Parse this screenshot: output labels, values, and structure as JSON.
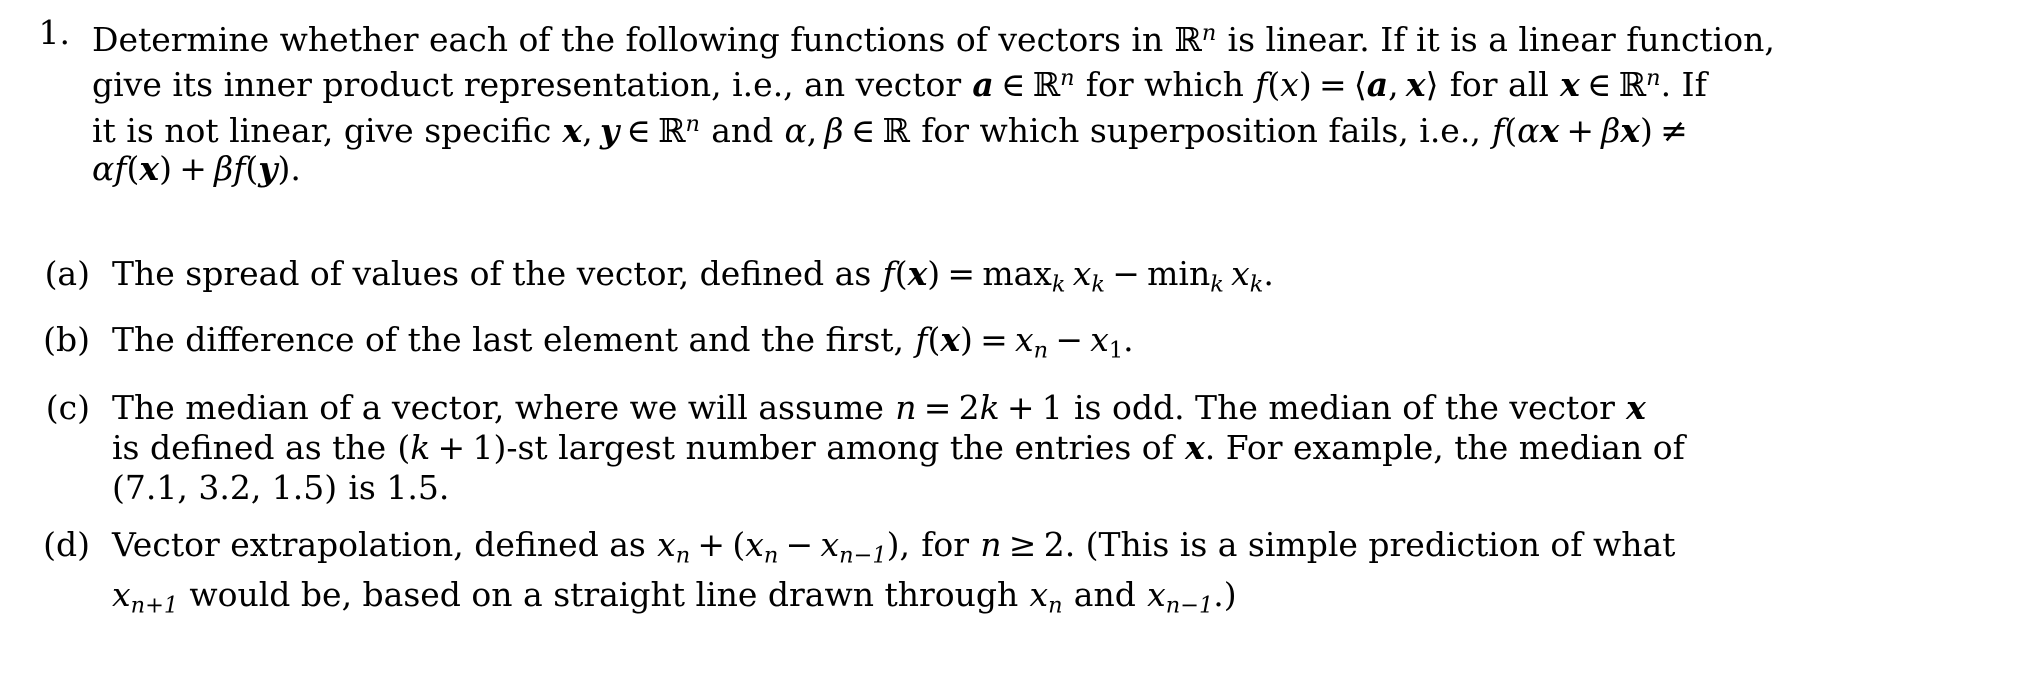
{
  "document": {
    "type": "latex-homework-problem",
    "background_color": "#ffffff",
    "text_color": "#000000"
  },
  "problem": {
    "number": "1.",
    "statement_lines": [
      "Determine whether each of the following functions of vectors in ℝⁿ is linear. If it is a linear function,",
      "give its inner product representation, i.e., an vector a ∈ ℝⁿ for which f(x) = ⟨a, x⟩ for all x ∈ ℝⁿ. If",
      "it is not linear, give specific x, y ∈ ℝⁿ and α, β ∈ ℝ for which superposition fails, i.e., f(αx + βx) ≠",
      "αf(x) + βf(y)."
    ],
    "line1": {
      "seg1": "Determine whether each of the following functions of vectors in",
      "R": "R",
      "exp_n": "n",
      "seg2": "is linear. If it is a linear function,"
    },
    "line2": {
      "seg1": "give its inner product representation, i.e., an vector",
      "a": "a",
      "in1": "∈",
      "R1": "R",
      "exp_n1": "n",
      "seg2": "for which",
      "f": "f",
      "paren_open": "(",
      "x_italic": "x",
      "paren_close": ")",
      "equals": "=",
      "angle_open": "⟨",
      "a2": "a",
      "comma": ",",
      "x_bold": "x",
      "angle_close": "⟩",
      "seg3": "for all",
      "x_bold2": "x",
      "in2": "∈",
      "R2": "R",
      "exp_n2": "n",
      "seg4": ". If"
    },
    "line3": {
      "seg1": "it is not linear, give specific",
      "x": "x",
      "comma1": ",",
      "y": "y",
      "in1": "∈",
      "R1": "R",
      "exp_n": "n",
      "seg2": "and",
      "alpha": "α",
      "comma2": ",",
      "beta": "β",
      "in2": "∈",
      "R2": "R",
      "seg3": "for which superposition fails, i.e.,",
      "f": "f",
      "paren_open": "(",
      "alpha2": "α",
      "x2": "x",
      "plus": "+",
      "beta2": "β",
      "x3": "x",
      "paren_close": ")",
      "neq": "≠"
    },
    "line4": {
      "alpha": "α",
      "f1": "f",
      "po1": "(",
      "x": "x",
      "pc1": ")",
      "plus": "+",
      "beta": "β",
      "f2": "f",
      "po2": "(",
      "y": "y",
      "pc2": ")",
      "period": "."
    }
  },
  "subitems": [
    {
      "label": "(a)",
      "id": "item-a",
      "text": "The spread of values of the vector, defined as f(x) = max_k x_k − min_k x_k.",
      "parts": {
        "seg1": "The spread of values of the vector, defined as",
        "f": "f",
        "po": "(",
        "x_bold": "x",
        "pc": ")",
        "eq": "=",
        "max": "max",
        "sub_k1": "k",
        "x1": "x",
        "sub_k2": "k",
        "minus": "−",
        "min": "min",
        "sub_k3": "k",
        "x2": "x",
        "sub_k4": "k",
        "period": "."
      }
    },
    {
      "label": "(b)",
      "id": "item-b",
      "text": "The difference of the last element and the first, f(x) = x_n − x_1.",
      "parts": {
        "seg1": "The difference of the last element and the first,",
        "f": "f",
        "po": "(",
        "x_bold": "x",
        "pc": ")",
        "eq": "=",
        "x1": "x",
        "sub_n": "n",
        "minus": "−",
        "x2": "x",
        "sub_1": "1",
        "period": "."
      }
    },
    {
      "label": "(c)",
      "id": "item-c",
      "text": "The median of a vector, where we will assume n = 2k + 1 is odd. The median of the vector x is defined as the (k + 1)-st largest number among the entries of x. For example, the median of (7.1, 3.2, 1.5) is 1.5.",
      "lines": {
        "l1_seg1": "The median of a vector, where we will assume",
        "l1_n": "n",
        "l1_eq": "=",
        "l1_2": "2",
        "l1_k": "k",
        "l1_plus": "+",
        "l1_1": "1",
        "l1_seg2": "is odd.  The median of the vector",
        "l1_x": "x",
        "l2_seg1": "is defined as the",
        "l2_po": "(",
        "l2_k": "k",
        "l2_plus": "+",
        "l2_1": "1",
        "l2_pc": ")",
        "l2_seg2": "-st largest number among the entries of",
        "l2_x": "x",
        "l2_seg3": ". For example, the median of",
        "l3_nums": "(7.1, 3.2, 1.5)",
        "l3_seg": "is 1.5."
      }
    },
    {
      "label": "(d)",
      "id": "item-d",
      "text": "Vector extrapolation, defined as x_n + (x_n − x_{n−1}), for n ≥ 2. (This is a simple prediction of what x_{n+1} would be, based on a straight line drawn through x_n and x_{n−1}.)",
      "lines": {
        "l1_seg1": "Vector extrapolation, defined as",
        "l1_x1": "x",
        "l1_sub_n1": "n",
        "l1_plus": "+",
        "l1_po": "(",
        "l1_x2": "x",
        "l1_sub_n2": "n",
        "l1_minus": "−",
        "l1_x3": "x",
        "l1_sub_nm1": "n−1",
        "l1_pc": ")",
        "l1_comma": ",",
        "l1_for": "for",
        "l1_n": "n",
        "l1_geq": "≥",
        "l1_2": "2",
        "l1_seg2": ". (This is a simple prediction of what",
        "l2_x": "x",
        "l2_sub_np1": "n+1",
        "l2_seg1": "would be, based on a straight line drawn through",
        "l2_x2": "x",
        "l2_sub_n": "n",
        "l2_and": "and",
        "l2_x3": "x",
        "l2_sub_nm1": "n−1",
        "l2_end": ".)"
      }
    }
  ]
}
